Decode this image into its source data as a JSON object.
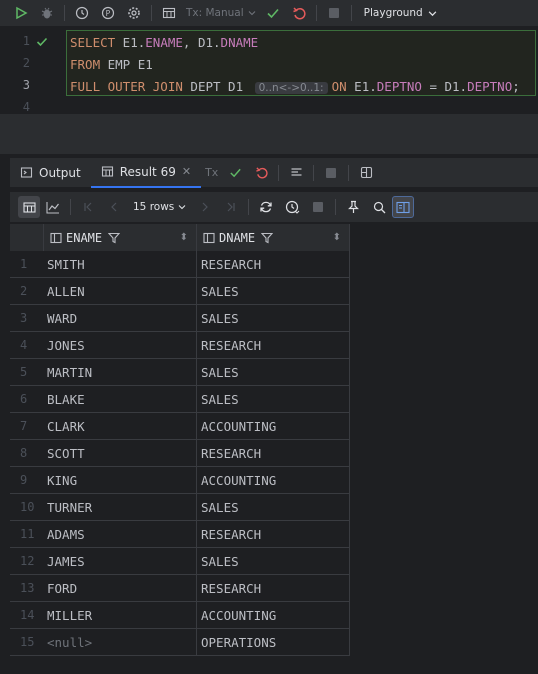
{
  "toolbar": {
    "tx_mode": "Tx: Manual",
    "playground_label": "Playground",
    "colors": {
      "run": "#5fb865",
      "commit": "#5fb865",
      "rollback": "#e55b5b"
    }
  },
  "editor": {
    "line_numbers": [
      "1",
      "2",
      "3",
      "4"
    ],
    "lines": [
      {
        "parts": [
          "SELECT",
          " E1.",
          "ENAME",
          ", D1.",
          "DNAME"
        ]
      },
      {
        "parts": [
          "FROM",
          " EMP E1"
        ]
      },
      {
        "parts": [
          "FULL OUTER JOIN",
          " DEPT D1 ",
          "0..n<->0..1:",
          " ",
          "ON",
          " E1.",
          "DEPTNO",
          " = D1.",
          "DEPTNO",
          ";"
        ]
      }
    ]
  },
  "tabs": {
    "output_label": "Output",
    "result_label": "Result 69",
    "tx_short": "Tx"
  },
  "results_toolbar": {
    "rows_label": "15 rows"
  },
  "grid": {
    "columns": [
      "ENAME",
      "DNAME"
    ],
    "rows": [
      {
        "n": "1",
        "ename": "SMITH",
        "dname": "RESEARCH"
      },
      {
        "n": "2",
        "ename": "ALLEN",
        "dname": "SALES"
      },
      {
        "n": "3",
        "ename": "WARD",
        "dname": "SALES"
      },
      {
        "n": "4",
        "ename": "JONES",
        "dname": "RESEARCH"
      },
      {
        "n": "5",
        "ename": "MARTIN",
        "dname": "SALES"
      },
      {
        "n": "6",
        "ename": "BLAKE",
        "dname": "SALES"
      },
      {
        "n": "7",
        "ename": "CLARK",
        "dname": "ACCOUNTING"
      },
      {
        "n": "8",
        "ename": "SCOTT",
        "dname": "RESEARCH"
      },
      {
        "n": "9",
        "ename": "KING",
        "dname": "ACCOUNTING"
      },
      {
        "n": "10",
        "ename": "TURNER",
        "dname": "SALES"
      },
      {
        "n": "11",
        "ename": "ADAMS",
        "dname": "RESEARCH"
      },
      {
        "n": "12",
        "ename": "JAMES",
        "dname": "SALES"
      },
      {
        "n": "13",
        "ename": "FORD",
        "dname": "RESEARCH"
      },
      {
        "n": "14",
        "ename": "MILLER",
        "dname": "ACCOUNTING"
      },
      {
        "n": "15",
        "ename": "<null>",
        "dname": "OPERATIONS"
      }
    ]
  }
}
